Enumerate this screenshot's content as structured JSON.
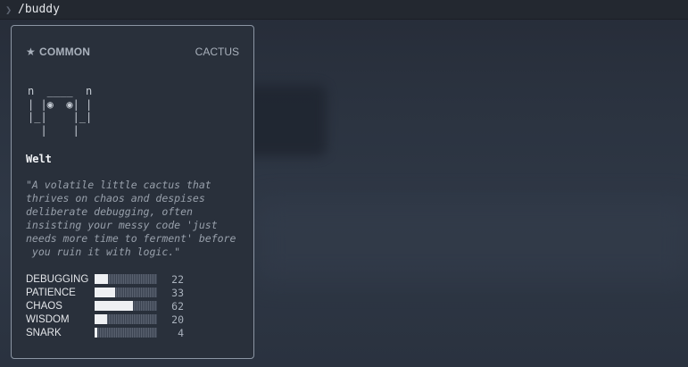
{
  "command": {
    "prompt_icon": "chevron-right-icon",
    "text": "/buddy"
  },
  "card": {
    "rarity_icon": "star-icon",
    "rarity": "COMMON",
    "species": "CACTUS",
    "ascii_art": "n  ____  n\n| |◉  ◉| |\n|_|    |_|\n  |    |",
    "name": "Welt",
    "description": "\"A volatile little cactus that\nthrives on chaos and despises\ndeliberate debugging, often\ninsisting your messy code 'just\nneeds more time to ferment' before\n you ruin it with logic.\"",
    "stats": [
      {
        "label": "DEBUGGING",
        "value": "22",
        "fraction": 0.22
      },
      {
        "label": "PATIENCE",
        "value": "33",
        "fraction": 0.33
      },
      {
        "label": "CHAOS",
        "value": "62",
        "fraction": 0.62
      },
      {
        "label": "WISDOM",
        "value": "20",
        "fraction": 0.2
      },
      {
        "label": "SNARK",
        "value": "4",
        "fraction": 0.04
      }
    ]
  }
}
